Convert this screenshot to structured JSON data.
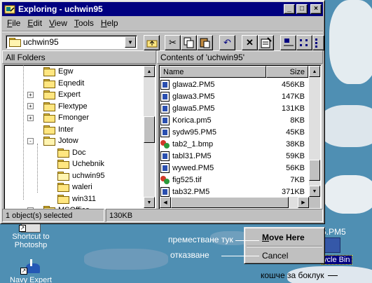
{
  "window": {
    "title": "Exploring - uchwin95",
    "caption_buttons": {
      "minimize": "_",
      "maximize": "□",
      "close": "×"
    }
  },
  "menu": [
    {
      "label": "File",
      "accel": "F"
    },
    {
      "label": "Edit",
      "accel": "E"
    },
    {
      "label": "View",
      "accel": "V"
    },
    {
      "label": "Tools",
      "accel": "T"
    },
    {
      "label": "Help",
      "accel": "H"
    }
  ],
  "toolbar": {
    "address_value": "uchwin95",
    "buttons": [
      "up-one-level",
      "cut",
      "copy",
      "paste",
      "undo",
      "delete",
      "properties",
      "large-icons",
      "small-icons",
      "list"
    ]
  },
  "left_pane": {
    "header": "All Folders",
    "tree": [
      {
        "label": "Egw",
        "expander": ""
      },
      {
        "label": "Eqnedit",
        "expander": ""
      },
      {
        "label": "Expert",
        "expander": "+"
      },
      {
        "label": "Flextype",
        "expander": "+"
      },
      {
        "label": "Fmonger",
        "expander": "+"
      },
      {
        "label": "Inter",
        "expander": ""
      },
      {
        "label": "Jotow",
        "expander": "-"
      },
      {
        "label": "Doc",
        "expander": ""
      },
      {
        "label": "Uchebnik",
        "expander": ""
      },
      {
        "label": "uchwin95",
        "expander": ""
      },
      {
        "label": "waleri",
        "expander": ""
      },
      {
        "label": "win311",
        "expander": ""
      },
      {
        "label": "MSOffice",
        "expander": "+"
      }
    ]
  },
  "right_pane": {
    "header": "Contents of 'uchwin95'",
    "columns": {
      "name": "Name",
      "size": "Size"
    },
    "files": [
      {
        "name": "glawa2.PM5",
        "size": "456KB",
        "icon": "pagemaker-doc-icon"
      },
      {
        "name": "glawa3.PM5",
        "size": "147KB",
        "icon": "pagemaker-doc-icon"
      },
      {
        "name": "glawa5.PM5",
        "size": "131KB",
        "icon": "pagemaker-doc-icon"
      },
      {
        "name": "Korica.pm5",
        "size": "8KB",
        "icon": "pagemaker-doc-icon"
      },
      {
        "name": "sydw95.PM5",
        "size": "45KB",
        "icon": "pagemaker-doc-icon"
      },
      {
        "name": "tab2_1.bmp",
        "size": "38KB",
        "icon": "image-file-icon"
      },
      {
        "name": "tabl31.PM5",
        "size": "59KB",
        "icon": "pagemaker-doc-icon"
      },
      {
        "name": "wywed.PM5",
        "size": "56KB",
        "icon": "pagemaker-doc-icon"
      },
      {
        "name": "fig525.tif",
        "size": "7KB",
        "icon": "image-file-icon"
      },
      {
        "name": "tab32.PM5",
        "size": "371KB",
        "icon": "pagemaker-doc-icon"
      }
    ]
  },
  "status_bar": {
    "selection": "1 object(s) selected",
    "size": "130KB"
  },
  "desktop": {
    "icons": [
      {
        "label_line1": "Shortcut to",
        "label_line2": "Photoshp"
      },
      {
        "label_line1": "Navy Expert",
        "label_line2": ""
      }
    ],
    "file_label_partial": "5.PM5",
    "recycle_bin_partial": "ycle Bin"
  },
  "context_menu": {
    "move_here": "Move Here",
    "move_here_accel": "M",
    "cancel": "Cancel"
  },
  "annotations": {
    "move_here_note": "преместване тук",
    "cancel_note": "отказване",
    "recycle_note": "кошче за боклук"
  }
}
